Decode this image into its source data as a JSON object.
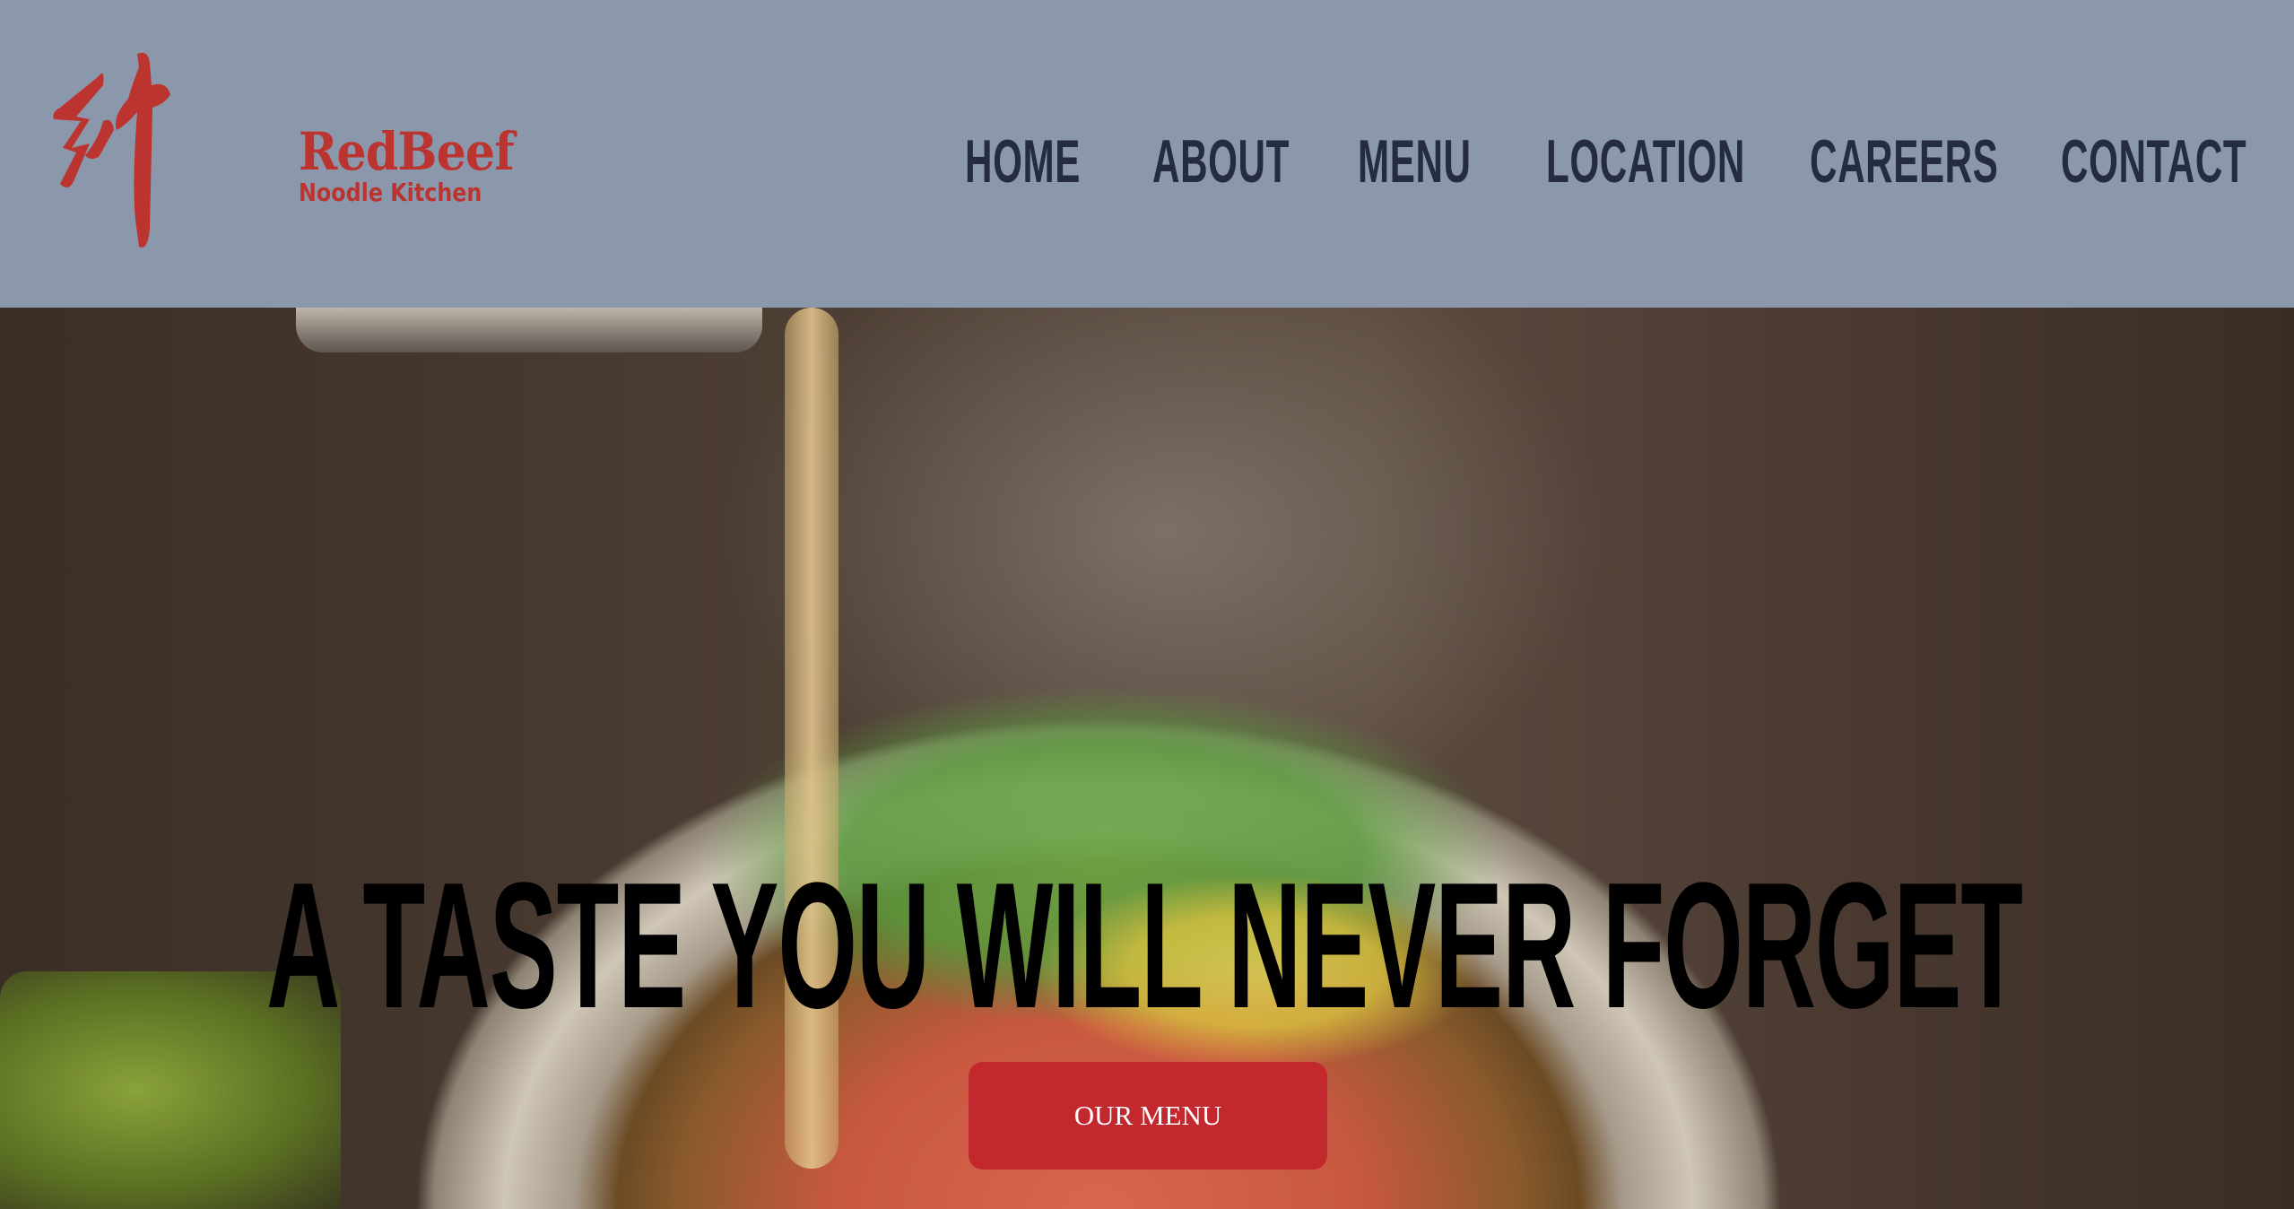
{
  "brand": {
    "logo_char": "紅牛",
    "name": "RedBeef",
    "tagline": "Noodle Kitchen",
    "color": "#bb3430"
  },
  "nav": {
    "items": [
      {
        "label": "HOME"
      },
      {
        "label": "ABOUT"
      },
      {
        "label": "MENU"
      },
      {
        "label": "LOCATION"
      },
      {
        "label": "CAREERS"
      },
      {
        "label": "CONTACT"
      }
    ]
  },
  "hero": {
    "headline": "A TASTE YOU WILL NEVER FORGET",
    "cta_label": "OUR MENU",
    "cta_color": "#c4282f"
  },
  "colors": {
    "header_bg": "#8b98ab",
    "nav_text": "#252b40"
  }
}
